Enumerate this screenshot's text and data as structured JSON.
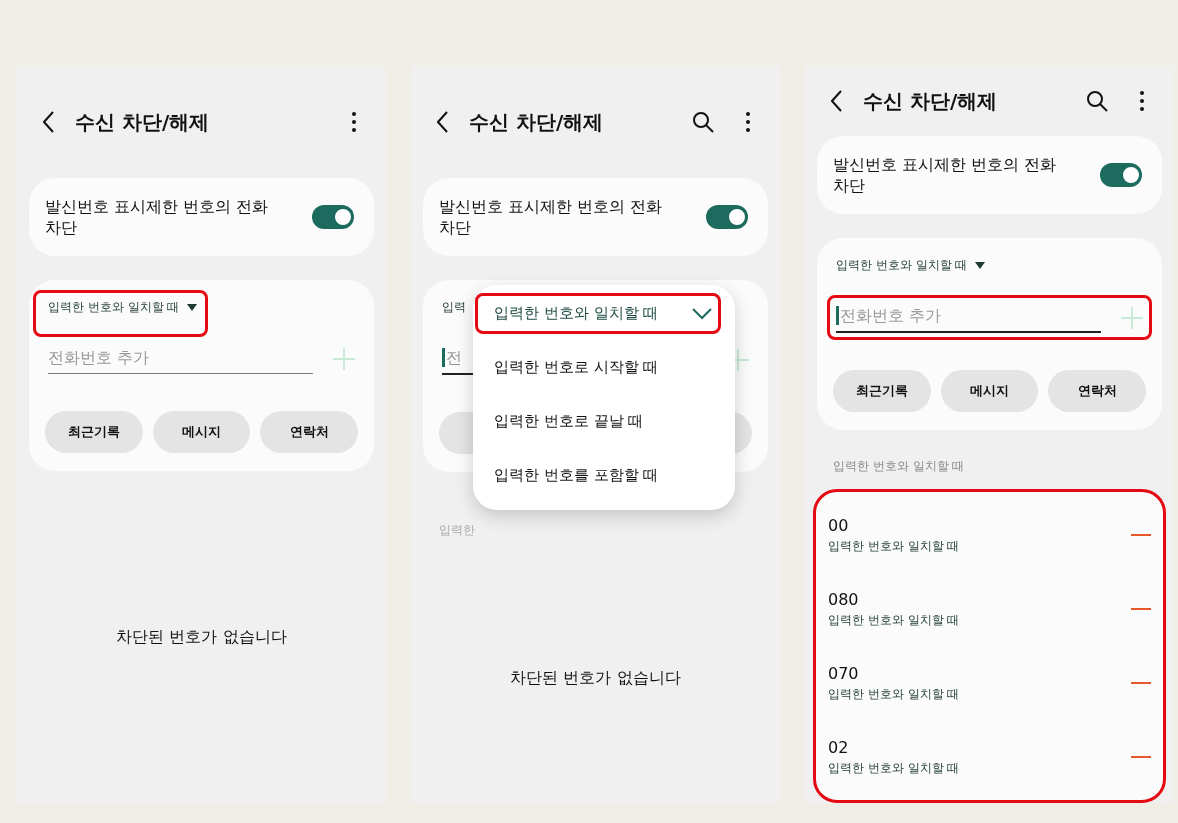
{
  "panels": [
    {
      "title": "수신 차단/해제",
      "search": false,
      "toggle": {
        "label": "발신번호 표시제한 번호의 전화 차단",
        "on": true
      },
      "match": {
        "label": "입력한 번호와 일치할 때",
        "highlighted": true
      },
      "field": {
        "placeholder": "전화번호 추가",
        "focused": false,
        "highlighted": false
      },
      "buttons": [
        "최근기록",
        "메시지",
        "연락처"
      ],
      "empty_message": "차단된 번호가 없습니다"
    },
    {
      "title": "수신 차단/해제",
      "search": true,
      "toggle": {
        "label": "발신번호 표시제한 번호의 전화 차단",
        "on": true
      },
      "match": {
        "label": "입력",
        "highlighted": false
      },
      "field": {
        "placeholder": "전",
        "focused": true,
        "highlighted": false
      },
      "menu": {
        "items": [
          {
            "label": "입력한 번호와 일치할 때",
            "selected": true,
            "highlighted": true
          },
          {
            "label": "입력한 번호로 시작할 때",
            "selected": false,
            "highlighted": false
          },
          {
            "label": "입력한 번호로 끝날 때",
            "selected": false,
            "highlighted": false
          },
          {
            "label": "입력한 번호를 포함할 때",
            "selected": false,
            "highlighted": false
          }
        ]
      },
      "section_header": "입력한",
      "empty_message": "차단된 번호가 없습니다"
    },
    {
      "title": "수신 차단/해제",
      "search": true,
      "toggle": {
        "label": "발신번호 표시제한 번호의 전화 차단",
        "on": true
      },
      "match": {
        "label": "입력한 번호와 일치할 때",
        "highlighted": false
      },
      "field": {
        "placeholder": "전화번호 추가",
        "focused": true,
        "highlighted": true
      },
      "buttons": [
        "최근기록",
        "메시지",
        "연락처"
      ],
      "section_header": "입력한 번호와 일치할 때",
      "blocked": {
        "highlighted": true,
        "items": [
          {
            "number": "00",
            "rule": "입력한 번호와 일치할 때"
          },
          {
            "number": "080",
            "rule": "입력한 번호와 일치할 때"
          },
          {
            "number": "070",
            "rule": "입력한 번호와 일치할 때"
          },
          {
            "number": "02",
            "rule": "입력한 번호와 일치할 때"
          }
        ]
      }
    }
  ]
}
